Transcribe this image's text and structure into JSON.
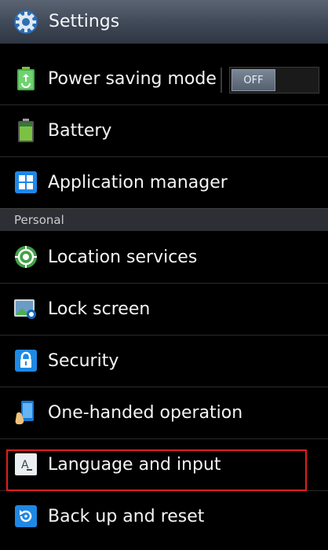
{
  "header": {
    "title": "Settings",
    "icon": "settings-gear-icon"
  },
  "items_top": [
    {
      "label": "Power saving mode",
      "icon": "power-saving-icon",
      "toggle": "OFF"
    },
    {
      "label": "Battery",
      "icon": "battery-icon"
    },
    {
      "label": "Application manager",
      "icon": "application-manager-icon"
    }
  ],
  "section": {
    "label": "Personal"
  },
  "items_personal": [
    {
      "label": "Location services",
      "icon": "location-icon"
    },
    {
      "label": "Lock screen",
      "icon": "lock-screen-icon"
    },
    {
      "label": "Security",
      "icon": "security-lock-icon"
    },
    {
      "label": "One-handed operation",
      "icon": "one-handed-icon"
    },
    {
      "label": "Language and input",
      "icon": "language-input-icon",
      "highlighted": true
    },
    {
      "label": "Back up and reset",
      "icon": "backup-reset-icon"
    }
  ],
  "colors": {
    "highlight": "#e11d1d",
    "section_bg": "#2c2f33",
    "accent_blue": "#1e88e5"
  }
}
